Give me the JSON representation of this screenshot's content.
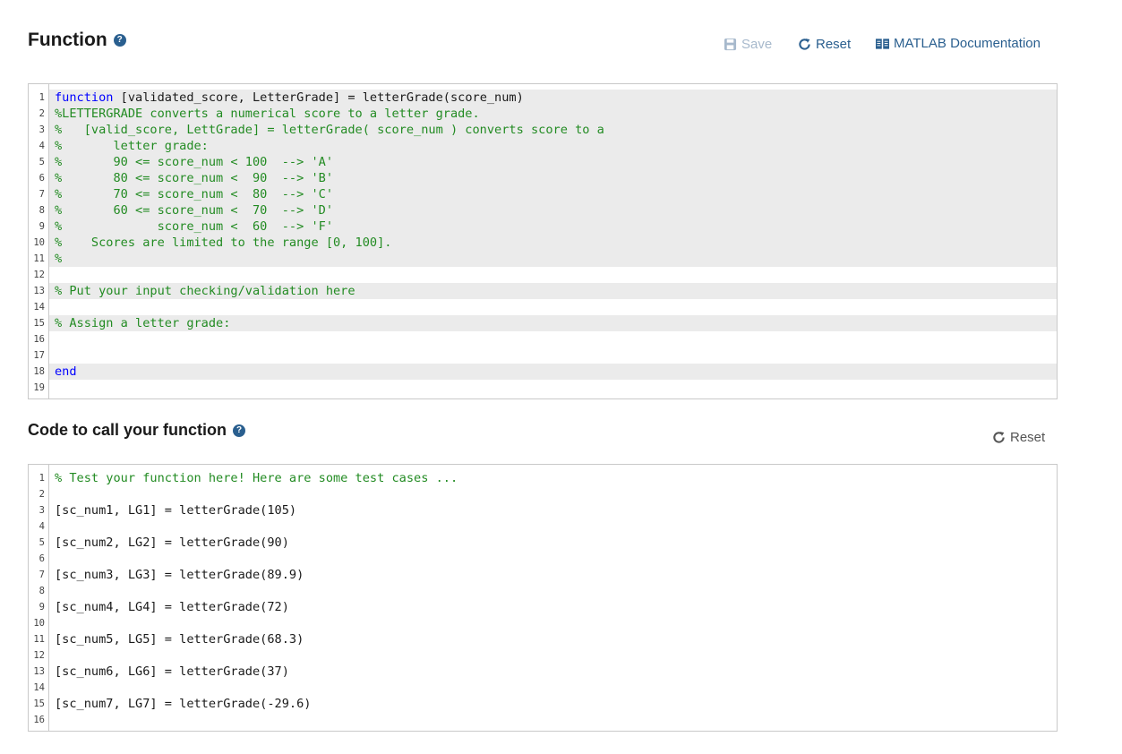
{
  "function_section": {
    "title": "Function",
    "help_icon": "question-circle-icon",
    "toolbar": {
      "save_label": "Save",
      "reset_label": "Reset",
      "docs_label": "MATLAB Documentation"
    },
    "lines": [
      {
        "num": "1",
        "locked": true,
        "segments": [
          {
            "t": "function",
            "c": "kw"
          },
          {
            "t": " [validated_score, LetterGrade] = letterGrade(score_num)",
            "c": "tx"
          }
        ]
      },
      {
        "num": "2",
        "locked": true,
        "segments": [
          {
            "t": "%LETTERGRADE converts a numerical score to a letter grade.",
            "c": "cm"
          }
        ]
      },
      {
        "num": "3",
        "locked": true,
        "segments": [
          {
            "t": "%   [valid_score, LettGrade] = letterGrade( score_num ) converts score to a",
            "c": "cm"
          }
        ]
      },
      {
        "num": "4",
        "locked": true,
        "segments": [
          {
            "t": "%       letter grade:",
            "c": "cm"
          }
        ]
      },
      {
        "num": "5",
        "locked": true,
        "segments": [
          {
            "t": "%       90 <= score_num < 100  --> 'A'",
            "c": "cm"
          }
        ]
      },
      {
        "num": "6",
        "locked": true,
        "segments": [
          {
            "t": "%       80 <= score_num <  90  --> 'B'",
            "c": "cm"
          }
        ]
      },
      {
        "num": "7",
        "locked": true,
        "segments": [
          {
            "t": "%       70 <= score_num <  80  --> 'C'",
            "c": "cm"
          }
        ]
      },
      {
        "num": "8",
        "locked": true,
        "segments": [
          {
            "t": "%       60 <= score_num <  70  --> 'D'",
            "c": "cm"
          }
        ]
      },
      {
        "num": "9",
        "locked": true,
        "segments": [
          {
            "t": "%             score_num <  60  --> 'F'",
            "c": "cm"
          }
        ]
      },
      {
        "num": "10",
        "locked": true,
        "segments": [
          {
            "t": "%    Scores are limited to the range [0, 100].",
            "c": "cm"
          }
        ]
      },
      {
        "num": "11",
        "locked": true,
        "segments": [
          {
            "t": "%",
            "c": "cm"
          }
        ]
      },
      {
        "num": "12",
        "locked": false,
        "segments": [
          {
            "t": "",
            "c": "tx"
          }
        ]
      },
      {
        "num": "13",
        "locked": true,
        "segments": [
          {
            "t": "% Put your input checking/validation here",
            "c": "cm"
          }
        ]
      },
      {
        "num": "14",
        "locked": false,
        "segments": [
          {
            "t": "",
            "c": "tx"
          }
        ]
      },
      {
        "num": "15",
        "locked": true,
        "segments": [
          {
            "t": "% Assign a letter grade:",
            "c": "cm"
          }
        ]
      },
      {
        "num": "16",
        "locked": false,
        "segments": [
          {
            "t": "",
            "c": "tx"
          }
        ]
      },
      {
        "num": "17",
        "locked": false,
        "segments": [
          {
            "t": "",
            "c": "tx"
          }
        ]
      },
      {
        "num": "18",
        "locked": true,
        "segments": [
          {
            "t": "end",
            "c": "kw"
          }
        ]
      },
      {
        "num": "19",
        "locked": false,
        "segments": [
          {
            "t": "",
            "c": "tx"
          }
        ]
      }
    ]
  },
  "call_section": {
    "title": "Code to call your function",
    "help_icon": "question-circle-icon",
    "reset_label": "Reset",
    "lines": [
      {
        "num": "1",
        "locked": false,
        "segments": [
          {
            "t": "% Test your function here! Here are some test cases ...",
            "c": "cm"
          }
        ]
      },
      {
        "num": "2",
        "locked": false,
        "segments": [
          {
            "t": "",
            "c": "tx"
          }
        ]
      },
      {
        "num": "3",
        "locked": false,
        "segments": [
          {
            "t": "[sc_num1, LG1] = letterGrade(105)",
            "c": "tx"
          }
        ]
      },
      {
        "num": "4",
        "locked": false,
        "segments": [
          {
            "t": "",
            "c": "tx"
          }
        ]
      },
      {
        "num": "5",
        "locked": false,
        "segments": [
          {
            "t": "[sc_num2, LG2] = letterGrade(90)",
            "c": "tx"
          }
        ]
      },
      {
        "num": "6",
        "locked": false,
        "segments": [
          {
            "t": "",
            "c": "tx"
          }
        ]
      },
      {
        "num": "7",
        "locked": false,
        "segments": [
          {
            "t": "[sc_num3, LG3] = letterGrade(89.9)",
            "c": "tx"
          }
        ]
      },
      {
        "num": "8",
        "locked": false,
        "segments": [
          {
            "t": "",
            "c": "tx"
          }
        ]
      },
      {
        "num": "9",
        "locked": false,
        "segments": [
          {
            "t": "[sc_num4, LG4] = letterGrade(72)",
            "c": "tx"
          }
        ]
      },
      {
        "num": "10",
        "locked": false,
        "segments": [
          {
            "t": "",
            "c": "tx"
          }
        ]
      },
      {
        "num": "11",
        "locked": false,
        "segments": [
          {
            "t": "[sc_num5, LG5] = letterGrade(68.3)",
            "c": "tx"
          }
        ]
      },
      {
        "num": "12",
        "locked": false,
        "segments": [
          {
            "t": "",
            "c": "tx"
          }
        ]
      },
      {
        "num": "13",
        "locked": false,
        "segments": [
          {
            "t": "[sc_num6, LG6] = letterGrade(37)",
            "c": "tx"
          }
        ]
      },
      {
        "num": "14",
        "locked": false,
        "segments": [
          {
            "t": "",
            "c": "tx"
          }
        ]
      },
      {
        "num": "15",
        "locked": false,
        "segments": [
          {
            "t": "[sc_num7, LG7] = letterGrade(-29.6)",
            "c": "tx"
          }
        ]
      },
      {
        "num": "16",
        "locked": false,
        "segments": [
          {
            "t": "",
            "c": "tx"
          }
        ]
      }
    ]
  }
}
